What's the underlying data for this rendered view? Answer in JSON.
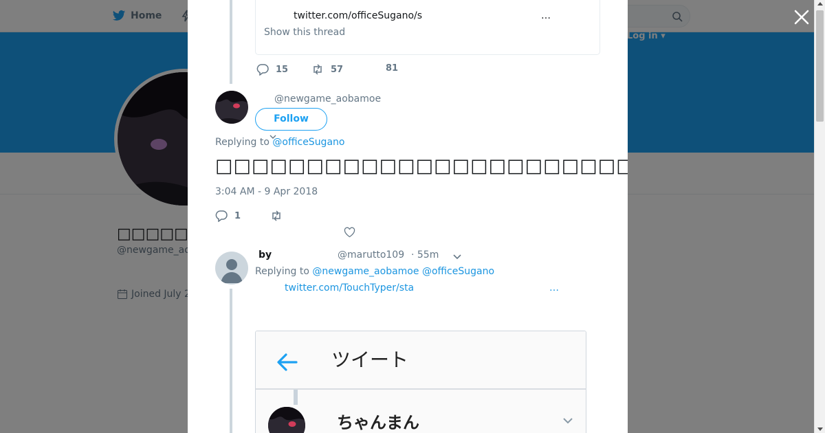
{
  "nav": {
    "home_label": "Home",
    "login_label": "Log in ▾"
  },
  "profile": {
    "name": "□□□□□",
    "handle": "@newgame_ao",
    "joined": "Joined July 2"
  },
  "quote": {
    "link_text": "twitter.com/officeSugano/s",
    "ellipsis": "…",
    "show_thread": "Show this thread"
  },
  "prev_tweet_actions": {
    "reply_count": "15",
    "retweet_count": "57",
    "like_count": "81"
  },
  "main_tweet": {
    "handle": "@newgame_aobamoe",
    "follow_label": "Follow",
    "replying_prefix": "Replying to ",
    "replying_to": "@officeSugano",
    "text": "□□□□□□□□□□□□□□□□□□□□□□□□□□□□□□□□□□□□□□",
    "timestamp": "3:04 AM - 9 Apr 2018",
    "reply_count": "1"
  },
  "reply": {
    "by_label": "by",
    "handle": "@marutto109",
    "time": "· 55m",
    "replying_prefix": "Replying to ",
    "replying_to_1": "@newgame_aobamoe",
    "replying_to_2": "@officeSugano",
    "link_text": "twitter.com/TouchTyper/sta",
    "ellipsis": "…"
  },
  "media": {
    "title": "ツイート",
    "name": "ちゃんまん"
  },
  "colors": {
    "accent": "#1da1f2",
    "link": "#1b95e0",
    "muted": "#657786"
  },
  "icons": [
    "twitter-bird-icon",
    "lightning-icon",
    "search-icon",
    "close-icon",
    "reply-icon",
    "retweet-icon",
    "heart-icon",
    "chevron-down-icon",
    "back-arrow-icon",
    "calendar-icon"
  ]
}
